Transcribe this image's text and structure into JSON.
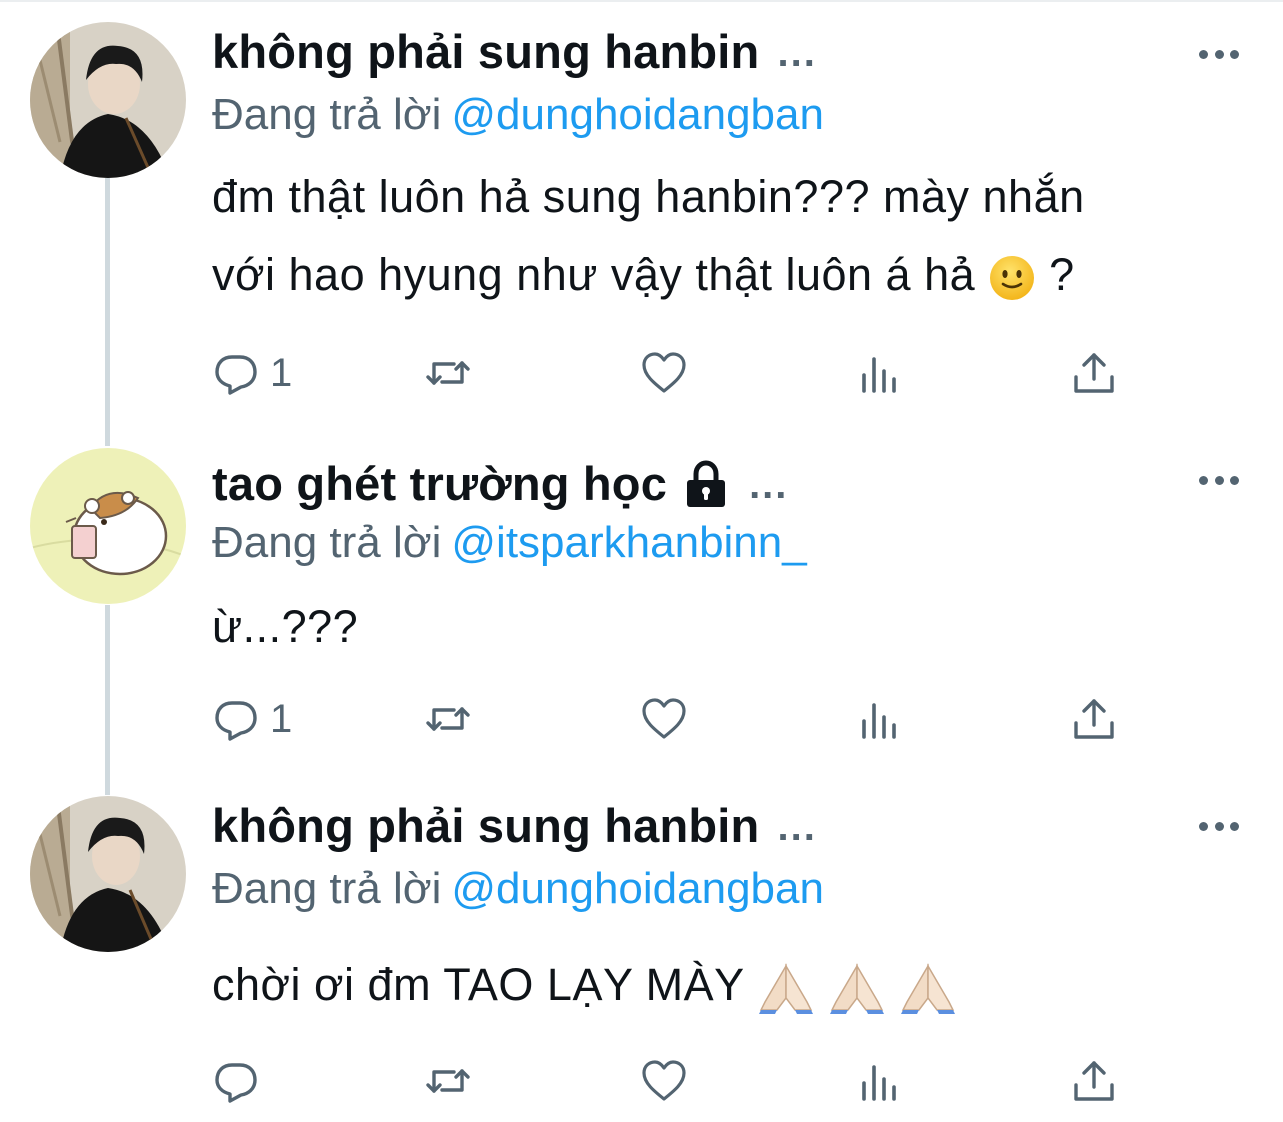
{
  "tweets": [
    {
      "author_name": "không phải sung hanbin",
      "truncation": "...",
      "reply_prefix": "Đang trả lời",
      "reply_to": "@dunghoidangban",
      "text_line1": "đm thật luôn hả sung hanbin??? mày nhắn",
      "text_line2": "với hao hyung như vậy thật luôn á hả",
      "text_line2_after": "?",
      "emoji": "slightly-smiling-face",
      "reply_count": "1",
      "avatar": "boy-in-black-jacket",
      "locked": false
    },
    {
      "author_name": "tao ghét trường học",
      "truncation": "...",
      "reply_prefix": "Đang trả lời",
      "reply_to": "@itsparkhanbinn_",
      "text_line1": "ừ...???",
      "reply_count": "1",
      "avatar": "hamster-cartoon",
      "locked": true
    },
    {
      "author_name": "không phải sung hanbin",
      "truncation": "...",
      "reply_prefix": "Đang trả lời",
      "reply_to": "@dunghoidangban",
      "text_line1": "chời ơi đm TAO LẠY MÀY",
      "emoji": "folded-hands x3",
      "reply_count": "",
      "avatar": "boy-in-black-jacket",
      "locked": false
    }
  ],
  "icons": {
    "reply": "reply-icon",
    "retweet": "retweet-icon",
    "like": "heart-icon",
    "views": "views-icon",
    "share": "share-icon",
    "more": "more-icon"
  },
  "colors": {
    "link": "#1d9bf0",
    "secondary": "#536471",
    "text": "#0f1419",
    "thread_line": "#cfd9de"
  }
}
